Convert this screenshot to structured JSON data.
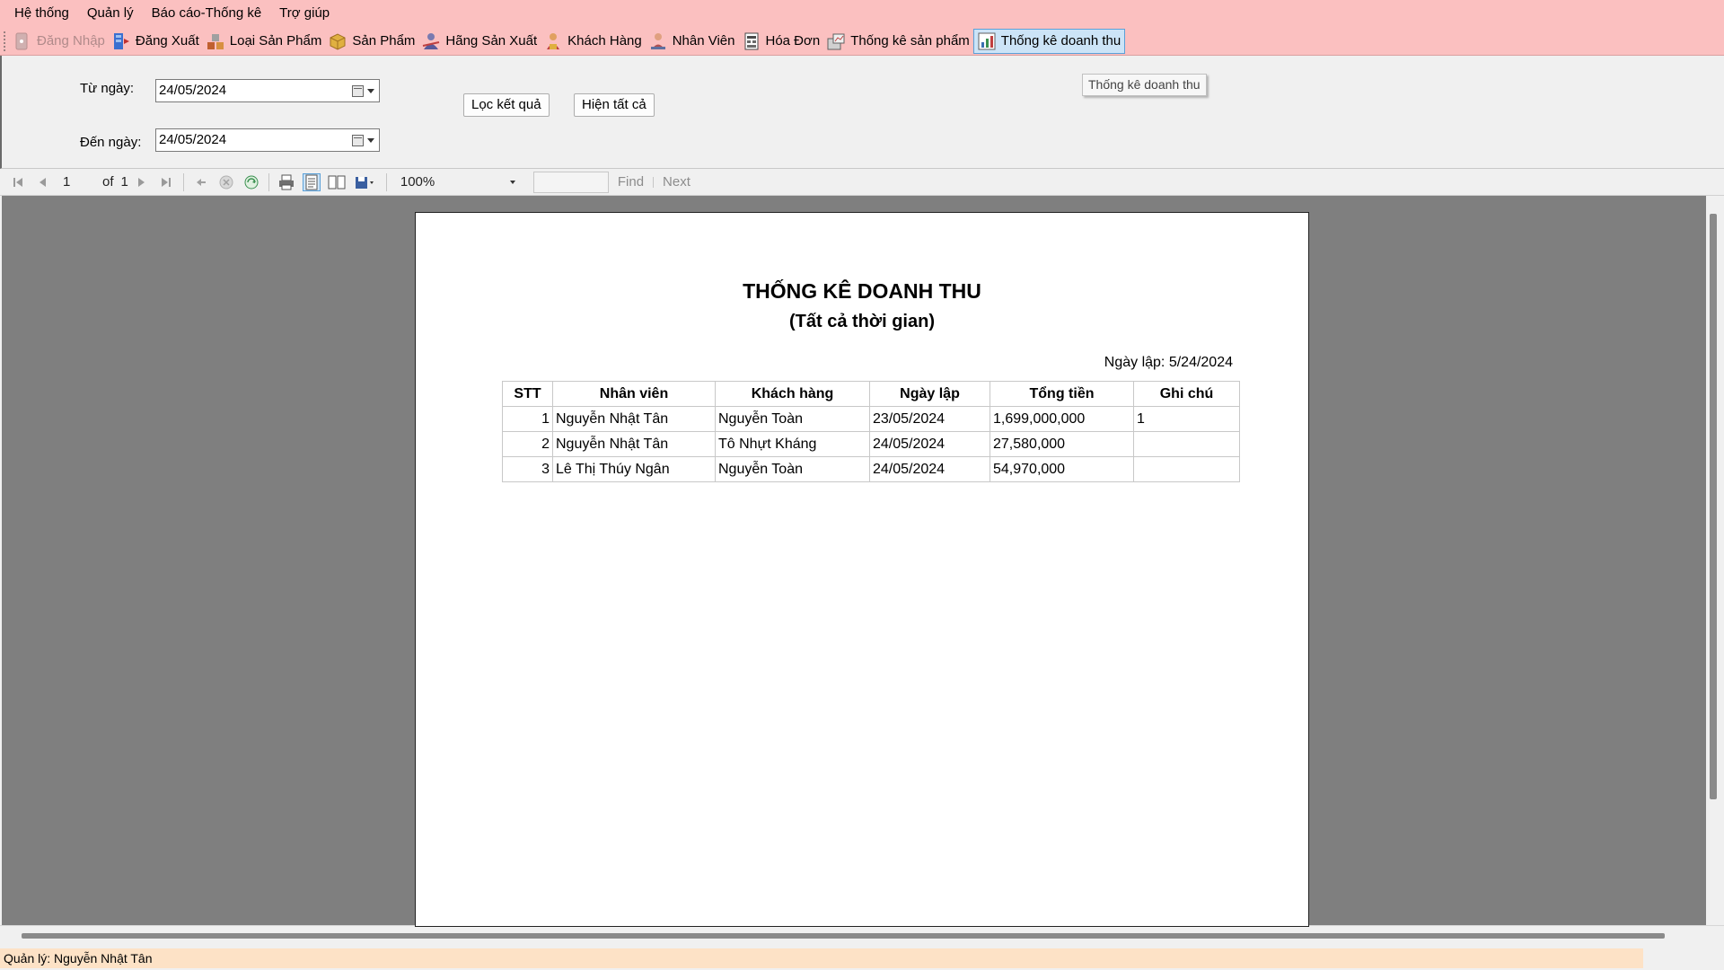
{
  "menu": [
    "Hệ thống",
    "Quản lý",
    "Báo cáo-Thống kê",
    "Trợ giúp"
  ],
  "toolbar": [
    {
      "label": "Đăng Nhập",
      "icon": "login-icon",
      "state": "disabled",
      "color": "#b0b0b0"
    },
    {
      "label": "Đăng Xuất",
      "icon": "logout-icon",
      "state": "normal",
      "color": "#3a6fd0"
    },
    {
      "label": "Loại Sản Phẩm",
      "icon": "category-icon",
      "state": "normal",
      "color": "#c06030"
    },
    {
      "label": "Sản Phẩm",
      "icon": "box-icon",
      "state": "normal",
      "color": "#d8a030"
    },
    {
      "label": "Hãng Sản Xuất",
      "icon": "manufacturer-icon",
      "state": "normal",
      "color": "#5a5a9a"
    },
    {
      "label": "Khách Hàng",
      "icon": "customer-icon",
      "state": "normal",
      "color": "#c04040"
    },
    {
      "label": "Nhân Viên",
      "icon": "employee-icon",
      "state": "normal",
      "color": "#b05050"
    },
    {
      "label": "Hóa Đơn",
      "icon": "invoice-icon",
      "state": "normal",
      "color": "#4a4a4a"
    },
    {
      "label": "Thống kê sản phẩm",
      "icon": "product-stats-icon",
      "state": "normal",
      "color": "#606060"
    },
    {
      "label": "Thống kê doanh thu",
      "icon": "revenue-chart-icon",
      "state": "active",
      "color": "#3a70b0"
    }
  ],
  "filter": {
    "from_label": "Từ ngày:",
    "from_value": "24/05/2024",
    "to_label": "Đến ngày:",
    "to_value": "24/05/2024",
    "filter_button": "Lọc kết quả",
    "show_all_button": "Hiện tất cả",
    "tooltip": "Thống kê doanh thu"
  },
  "viewer": {
    "page": "1",
    "of_label": "of",
    "total_pages": "1",
    "zoom": "100%",
    "find_label": "Find",
    "next_label": "Next"
  },
  "report": {
    "title": "THỐNG KÊ DOANH THU",
    "subtitle": "(Tất cả thời gian)",
    "date_line": "Ngày lập: 5/24/2024",
    "headers": [
      "STT",
      "Nhân viên",
      "Khách hàng",
      "Ngày lập",
      "Tổng tiền",
      "Ghi chú"
    ],
    "rows": [
      [
        "1",
        "Nguyễn Nhật Tân",
        "Nguyễn Toàn",
        "23/05/2024",
        "1,699,000,000",
        "1"
      ],
      [
        "2",
        "Nguyễn Nhật Tân",
        "Tô Nhựt Kháng",
        "24/05/2024",
        "27,580,000",
        ""
      ],
      [
        "3",
        "Lê Thị Thúy Ngân",
        "Nguyễn Toàn",
        "24/05/2024",
        "54,970,000",
        ""
      ]
    ]
  },
  "status": {
    "text": "Quản lý: Nguyễn Nhật Tân"
  }
}
